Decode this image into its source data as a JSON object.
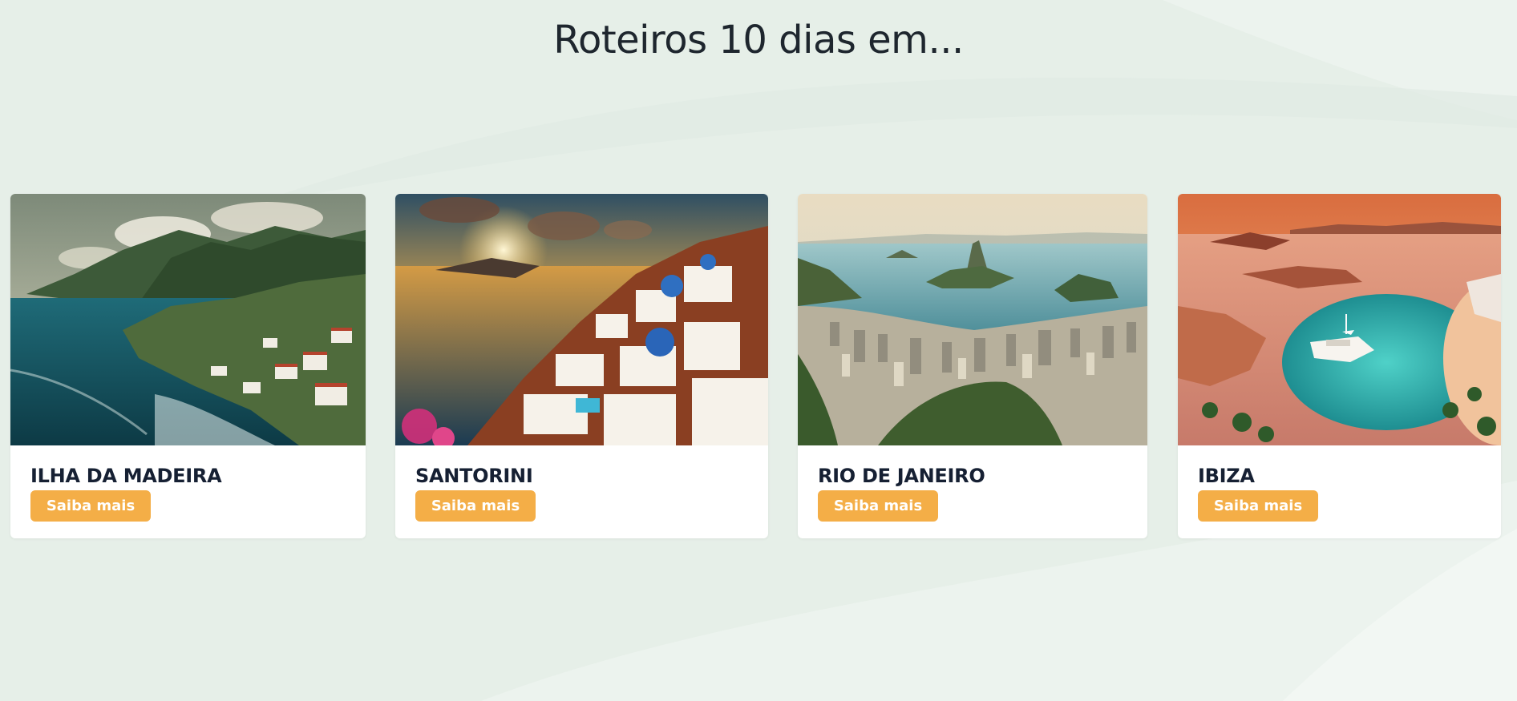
{
  "page": {
    "title": "Roteiros 10 dias em..."
  },
  "cards": [
    {
      "name": "ILHA DA MADEIRA",
      "button_label": "Saiba mais",
      "image_subject": "coastal cliffs with village and ocean"
    },
    {
      "name": "SANTORINI",
      "button_label": "Saiba mais",
      "image_subject": "white and blue domed houses on cliff at sunset"
    },
    {
      "name": "RIO DE JANEIRO",
      "button_label": "Saiba mais",
      "image_subject": "aerial view of city, bay and Sugarloaf mountain"
    },
    {
      "name": "IBIZA",
      "button_label": "Saiba mais",
      "image_subject": "turquoise bay with yacht and beach at sunset"
    }
  ],
  "colors": {
    "background": "#e6efe8",
    "card_background": "#ffffff",
    "button_background": "#f4ae47",
    "button_text": "#ffffff",
    "title_text": "#1e262e",
    "card_title_text": "#162033"
  }
}
